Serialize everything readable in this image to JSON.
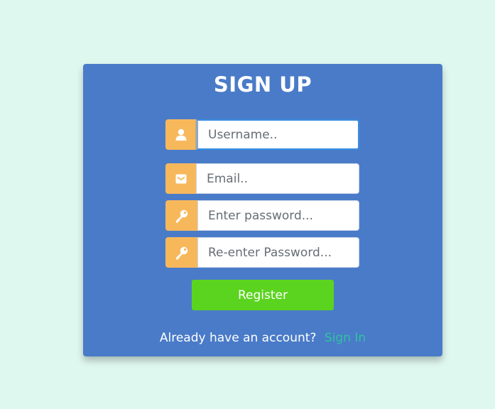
{
  "form": {
    "title": "SIGN UP",
    "fields": [
      {
        "icon": "user-icon",
        "value": "",
        "placeholder": "Username.."
      },
      {
        "icon": "envelope-icon",
        "value": "",
        "placeholder": "Email.."
      },
      {
        "icon": "key-icon",
        "value": "",
        "placeholder": "Enter password..."
      },
      {
        "icon": "key-icon",
        "value": "",
        "placeholder": "Re-enter Password..."
      }
    ],
    "register_label": "Register",
    "footer_text": "Already have an account?",
    "signin_label": "Sign In"
  },
  "colors": {
    "background": "#dff8ef",
    "card": "#4a7bc8",
    "icon_box": "#f7b85c",
    "register_button": "#5bd41f",
    "link": "#2fc3a0"
  }
}
